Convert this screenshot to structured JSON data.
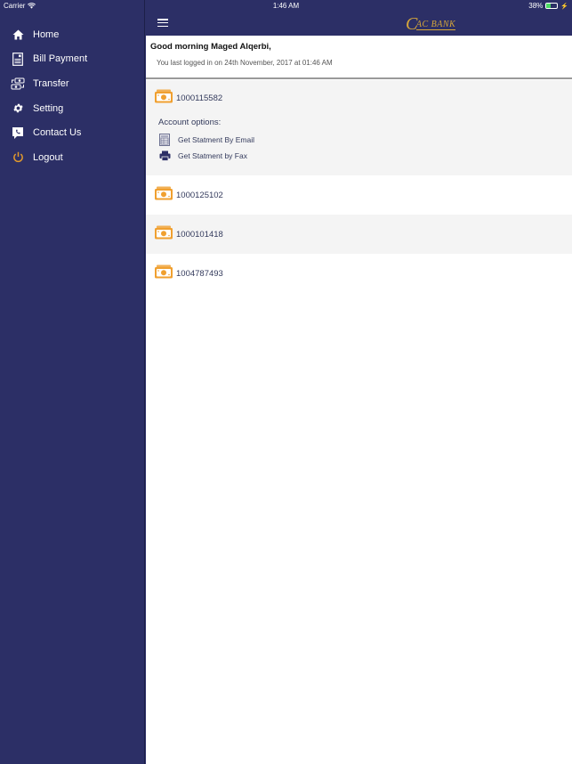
{
  "status_bar": {
    "carrier": "Carrier",
    "time": "1:46 AM",
    "battery": "38%",
    "battery_level_percent": 38
  },
  "sidebar": {
    "items": [
      {
        "label": "Home",
        "icon": "home-icon"
      },
      {
        "label": "Bill Payment",
        "icon": "bill-icon"
      },
      {
        "label": "Transfer",
        "icon": "transfer-icon"
      },
      {
        "label": "Setting",
        "icon": "gear-icon"
      },
      {
        "label": "Contact Us",
        "icon": "contact-phone-icon"
      },
      {
        "label": "Logout",
        "icon": "power-icon"
      }
    ]
  },
  "navbar": {
    "logo_initial": "C",
    "logo_rest": "AC BANK"
  },
  "greeting": {
    "title": "Good morning Maged Alqerbi,",
    "last_login": "You last logged in on 24th November, 2017 at 01:46 AM"
  },
  "accounts": [
    {
      "number": "1000115582",
      "expanded": true,
      "options_header": "Account options:",
      "options": [
        {
          "label": "Get Statment By Email",
          "icon": "statement-document-icon"
        },
        {
          "label": "Get Statment by Fax",
          "icon": "printer-icon"
        }
      ]
    },
    {
      "number": "1000125102"
    },
    {
      "number": "1000101418"
    },
    {
      "number": "1004787493"
    }
  ],
  "colors": {
    "navy": "#2c2f66",
    "accent_orange": "#f0a030",
    "logo_gold": "#d8a83a"
  }
}
